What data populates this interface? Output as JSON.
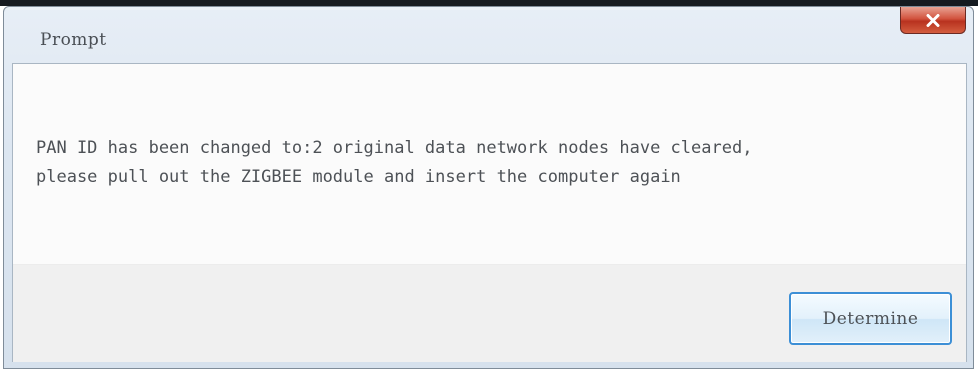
{
  "dialog": {
    "title": "Prompt",
    "close_icon": "close-icon",
    "message_line1": "PAN ID has been changed to:2 original data network nodes have cleared,",
    "message_line2": "please pull out the ZIGBEE module and insert the computer again",
    "determine_label": "Determine"
  },
  "colors": {
    "close_button": "#c8452f",
    "button_border": "#3c8fd6",
    "text": "#4d5156"
  }
}
